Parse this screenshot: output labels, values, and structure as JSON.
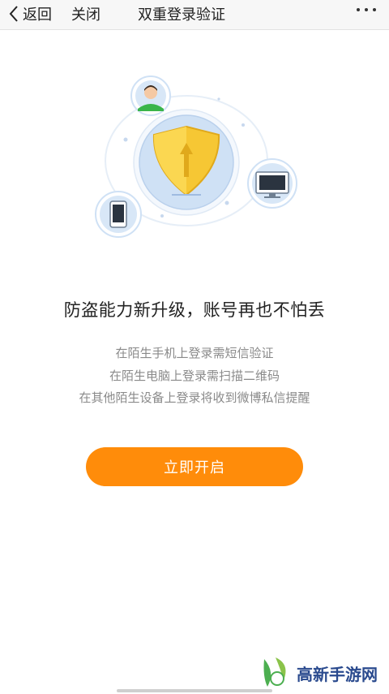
{
  "nav": {
    "back_label": "返回",
    "close_label": "关闭",
    "title": "双重登录验证"
  },
  "content": {
    "headline": "防盗能力新升级，账号再也不怕丢",
    "lines": [
      "在陌生手机上登录需短信验证",
      "在陌生电脑上登录需扫描二维码",
      "在其他陌生设备上登录将收到微博私信提醒"
    ]
  },
  "cta": {
    "label": "立即开启"
  },
  "watermark": {
    "text": "高新手游网"
  },
  "colors": {
    "accent": "#ff8c0a",
    "shield": "#f6c734",
    "ring": "#cfe1f5"
  },
  "icons": [
    "chevron-left-icon",
    "more-icon",
    "user-avatar-icon",
    "shield-icon",
    "monitor-icon",
    "phone-icon"
  ]
}
